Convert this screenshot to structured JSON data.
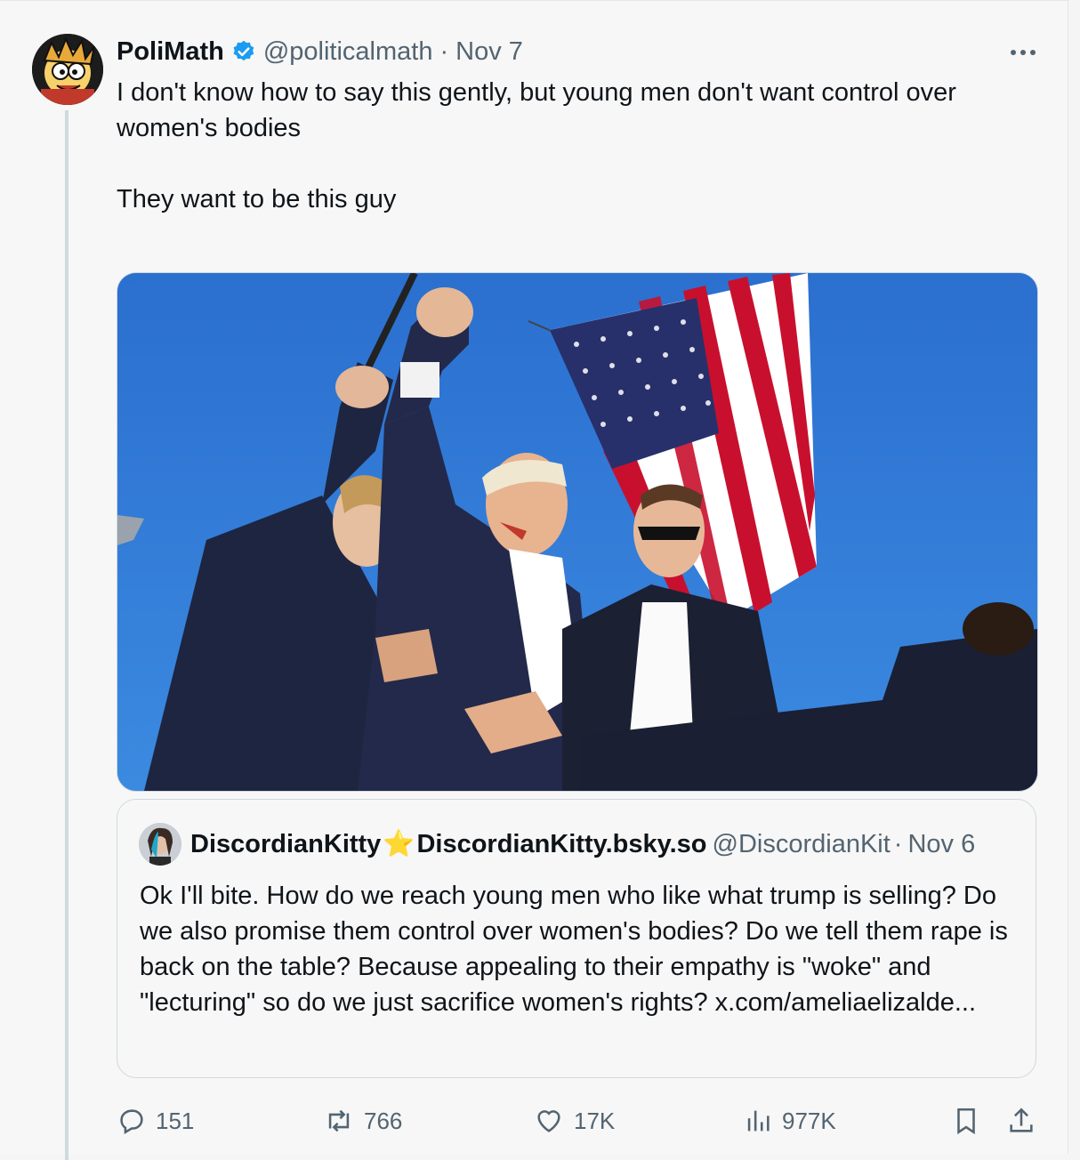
{
  "tweet": {
    "author_name": "PoliMath",
    "handle": "@politicalmath",
    "separator": "·",
    "date": "Nov 7",
    "text_line1": "I don't know how to say this gently, but young men don't want control over women's bodies",
    "text_line2": "They want to be this guy",
    "verified": true,
    "accent_color": "#1d9bf0"
  },
  "media": {
    "icons": [
      "flag-image",
      "photo"
    ]
  },
  "quote": {
    "name": "DiscordianKitty",
    "star": "⭐",
    "name2": "DiscordianKitty.bsky.so",
    "handle": "@DiscordianKit",
    "separator": "·",
    "date": "Nov 6",
    "text": "Ok I'll bite. How do we reach young men who like what trump is selling? Do we also promise them control over women's bodies? Do we tell them rape is back on the table? Because appealing to their empathy is \"woke\" and \"lecturing\" so do we just sacrifice women's rights? x.com/ameliaelizalde..."
  },
  "actions": {
    "replies": "151",
    "reposts": "766",
    "likes": "17K",
    "views": "977K"
  }
}
